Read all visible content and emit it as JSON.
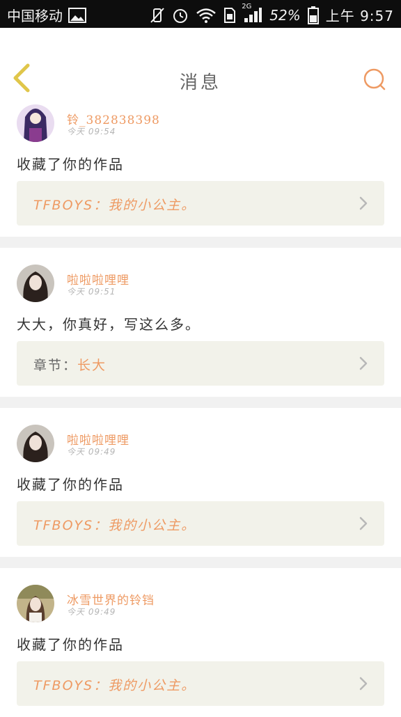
{
  "status_bar": {
    "carrier": "中国移动",
    "network": "2G",
    "battery": "52%",
    "time": "上午 9:57"
  },
  "header": {
    "title": "消息"
  },
  "messages": [
    {
      "username": "铃_382838398",
      "time": "今天 09:54",
      "content": "收藏了你的作品",
      "ref_text": "TFBOYS：我的小公主。"
    },
    {
      "username": "啦啦啦哩哩",
      "time": "今天 09:51",
      "content": "大大，你真好，写这么多。",
      "ref_label": "章节：",
      "ref_text": "长大"
    },
    {
      "username": "啦啦啦哩哩",
      "time": "今天 09:49",
      "content": "收藏了你的作品",
      "ref_text": "TFBOYS：我的小公主。"
    },
    {
      "username": "冰雪世界的铃铛",
      "time": "今天 09:49",
      "content": "收藏了你的作品",
      "ref_text": "TFBOYS：我的小公主。"
    }
  ],
  "icons": {
    "back": "chevron-left-icon",
    "search": "search-icon",
    "ref_arrow": "chevron-right-icon"
  },
  "colors": {
    "accent": "#ee9a63",
    "back_icon": "#e0c64a",
    "ref_bg": "#f2f2ea"
  }
}
